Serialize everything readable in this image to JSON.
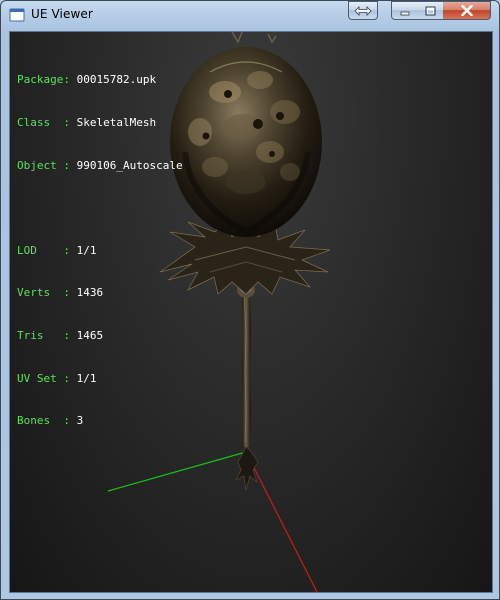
{
  "window": {
    "title": "UE Viewer",
    "icon": "ue-viewer-app-icon",
    "buttons": {
      "extra": "double-arrow-icon",
      "minimize": "minimize-icon",
      "maximize": "maximize-icon",
      "close": "close-icon"
    }
  },
  "info": {
    "package_key": "Package:",
    "package_value": "00015782.upk",
    "class_key": "Class  :",
    "class_value": "SkeletalMesh",
    "object_key": "Object :",
    "object_value": "990106_Autoscale",
    "lod_key": "LOD    :",
    "lod_value": "1/1",
    "verts_key": "Verts  :",
    "verts_value": "1436",
    "tris_key": "Tris   :",
    "tris_value": "1465",
    "uvset_key": "UV Set :",
    "uvset_value": "1/1",
    "bones_key": "Bones  :",
    "bones_value": "3"
  },
  "colors": {
    "info_key": "#5be05b",
    "info_value": "#ffffff",
    "axis_x": "#d01818",
    "axis_y": "#18c018",
    "viewport_bg": "#2a2a2a"
  }
}
